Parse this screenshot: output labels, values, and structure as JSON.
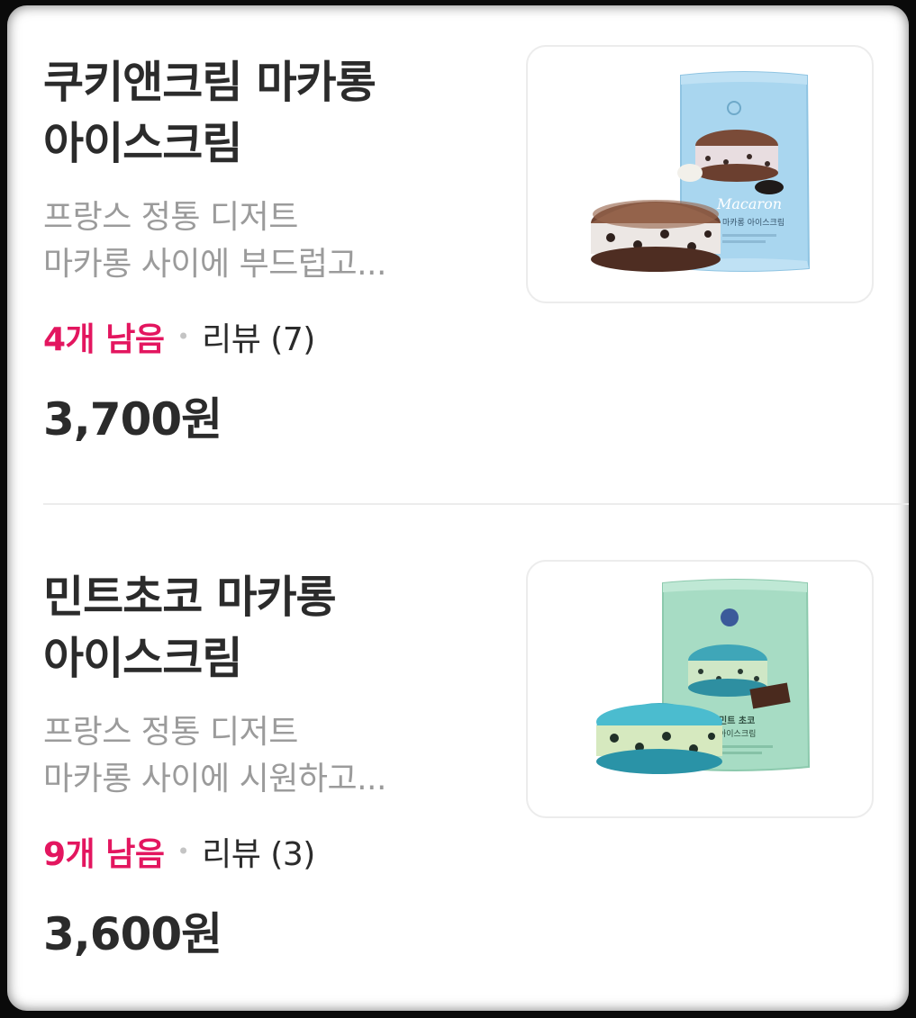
{
  "products": [
    {
      "name": "쿠키앤크림 마카롱\n아이스크림",
      "description": "프랑스 정통 디저트\n마카롱 사이에 부드럽고...",
      "stock": "4개 남음",
      "separator": "•",
      "review": "리뷰 (7)",
      "price": "3,700원",
      "package_color": "#a9d6ef",
      "package_text": "Macaron",
      "package_subtext": "마카롱 아이스크림"
    },
    {
      "name": "민트초코 마카롱\n아이스크림",
      "description": "프랑스 정통 디저트\n마카롱 사이에 시원하고...",
      "stock": "9개 남음",
      "separator": "•",
      "review": "리뷰 (3)",
      "price": "3,600원",
      "package_color": "#a7dcc4",
      "package_text": "민트 초코",
      "package_subtext": "아이스크림"
    }
  ],
  "colors": {
    "stock_accent": "#e3165f",
    "title": "#2b2b2b",
    "description": "#9b9b9b"
  }
}
